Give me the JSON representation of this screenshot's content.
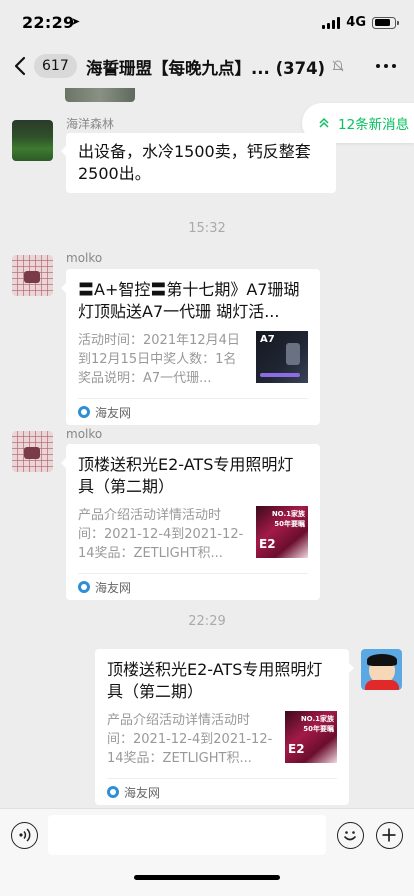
{
  "status": {
    "time": "22:29",
    "network": "4G"
  },
  "nav": {
    "unread_count": "617",
    "title": "海誓珊盟【每晚九点】...",
    "member_count": "(374)"
  },
  "new_messages": "12条新消息",
  "messages": [
    {
      "sender": "海洋森林",
      "text": "出设备，水冷1500卖，钙反整套2500出。"
    },
    {
      "time": "15:32"
    },
    {
      "sender": "molko",
      "card": {
        "title": "〓A+智控〓第十七期》A7珊瑚灯顶贴送A7一代珊 瑚灯活...",
        "desc": "活动时间：2021年12月4日到12月15日中奖人数：1名奖品说明：A7一代珊...",
        "thumb_text": "A7",
        "source": "海友网"
      }
    },
    {
      "sender": "molko",
      "card": {
        "title": "顶楼送积光E2-ATS专用照明灯具（第二期）",
        "desc": "产品介绍活动详情活动时间：2021-12-4到2021-12-14奖品：ZETLIGHT积...",
        "thumb_texts": [
          "NO.1家族",
          "50年要瞩",
          "E2"
        ],
        "source": "海友网"
      }
    },
    {
      "time": "22:29"
    },
    {
      "sender": "me",
      "card": {
        "title": "顶楼送积光E2-ATS专用照明灯具（第二期）",
        "desc": "产品介绍活动详情活动时间：2021-12-4到2021-12-14奖品：ZETLIGHT积...",
        "thumb_texts": [
          "NO.1家族",
          "50年要瞩",
          "E2"
        ],
        "source": "海友网"
      }
    }
  ],
  "composer": {
    "placeholder": ""
  }
}
